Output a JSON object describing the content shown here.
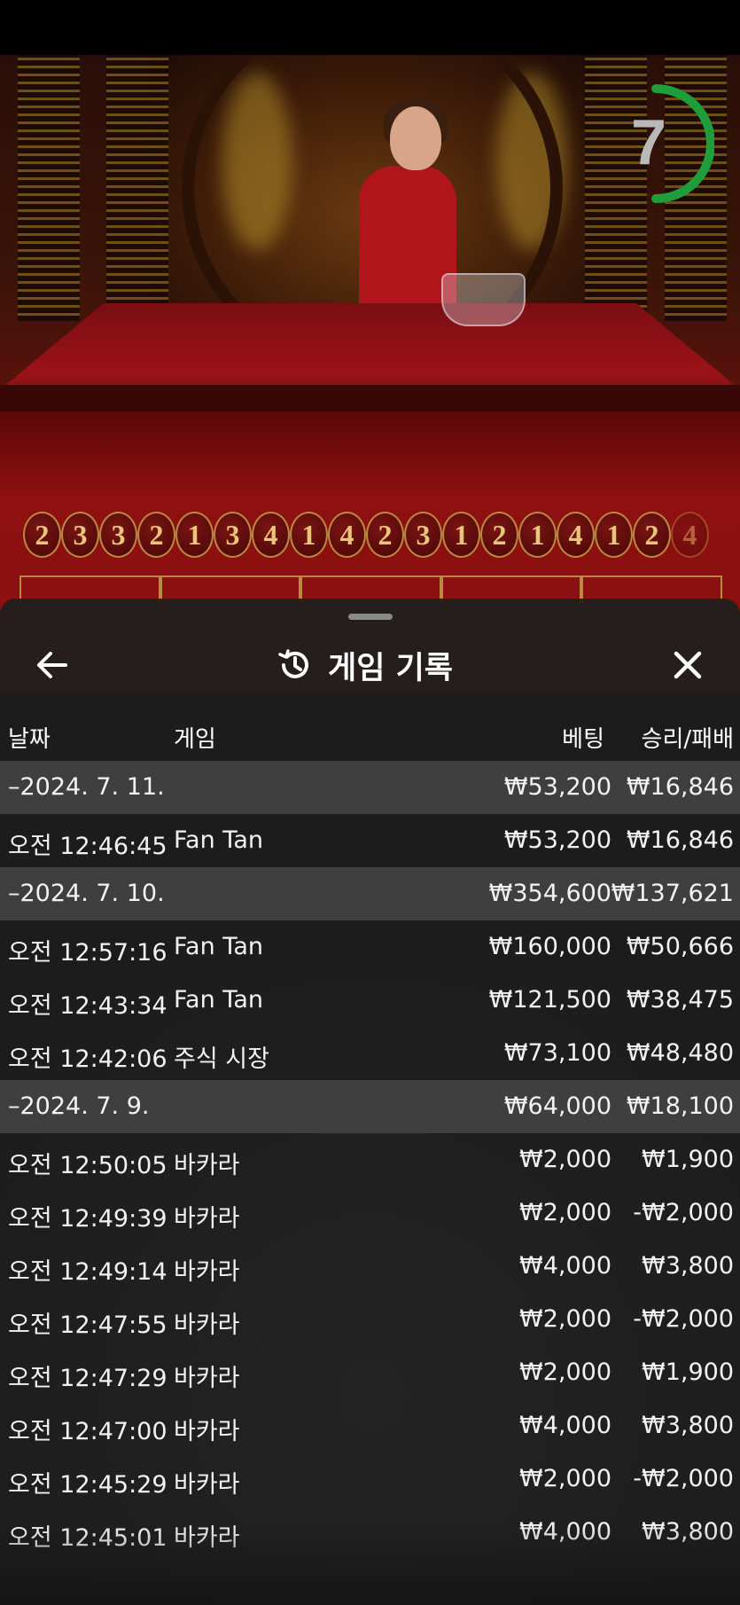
{
  "game": {
    "timer_value": "7",
    "history": [
      "2",
      "3",
      "3",
      "2",
      "1",
      "3",
      "4",
      "1",
      "4",
      "2",
      "3",
      "1",
      "2",
      "1",
      "4",
      "1",
      "2",
      "4"
    ]
  },
  "sheet": {
    "title": "게임 기록",
    "icons": {
      "back": "arrow-left-icon",
      "history": "history-clock-icon",
      "close": "close-icon"
    },
    "columns": {
      "date": "날짜",
      "game": "게임",
      "bet": "베팅",
      "win_loss": "승리/패배"
    },
    "groups": [
      {
        "date": "–2024. 7. 11.",
        "bet": "₩53,200",
        "win": "₩16,846",
        "rows": [
          {
            "time": "오전 12:46:45",
            "game": "Fan Tan",
            "bet": "₩53,200",
            "win": "₩16,846"
          }
        ]
      },
      {
        "date": "–2024. 7. 10.",
        "bet": "₩354,600",
        "win": "₩137,621",
        "rows": [
          {
            "time": "오전 12:57:16",
            "game": "Fan Tan",
            "bet": "₩160,000",
            "win": "₩50,666"
          },
          {
            "time": "오전 12:43:34",
            "game": "Fan Tan",
            "bet": "₩121,500",
            "win": "₩38,475"
          },
          {
            "time": "오전 12:42:06",
            "game": "주식 시장",
            "bet": "₩73,100",
            "win": "₩48,480"
          }
        ]
      },
      {
        "date": "–2024. 7. 9.",
        "bet": "₩64,000",
        "win": "₩18,100",
        "rows": [
          {
            "time": "오전 12:50:05",
            "game": "바카라",
            "bet": "₩2,000",
            "win": "₩1,900"
          },
          {
            "time": "오전 12:49:39",
            "game": "바카라",
            "bet": "₩2,000",
            "win": "-₩2,000"
          },
          {
            "time": "오전 12:49:14",
            "game": "바카라",
            "bet": "₩4,000",
            "win": "₩3,800"
          },
          {
            "time": "오전 12:47:55",
            "game": "바카라",
            "bet": "₩2,000",
            "win": "-₩2,000"
          },
          {
            "time": "오전 12:47:29",
            "game": "바카라",
            "bet": "₩2,000",
            "win": "₩1,900"
          },
          {
            "time": "오전 12:47:00",
            "game": "바카라",
            "bet": "₩4,000",
            "win": "₩3,800"
          },
          {
            "time": "오전 12:45:29",
            "game": "바카라",
            "bet": "₩2,000",
            "win": "-₩2,000"
          },
          {
            "time": "오전 12:45:01",
            "game": "바카라",
            "bet": "₩4,000",
            "win": "₩3,800"
          }
        ]
      }
    ]
  }
}
